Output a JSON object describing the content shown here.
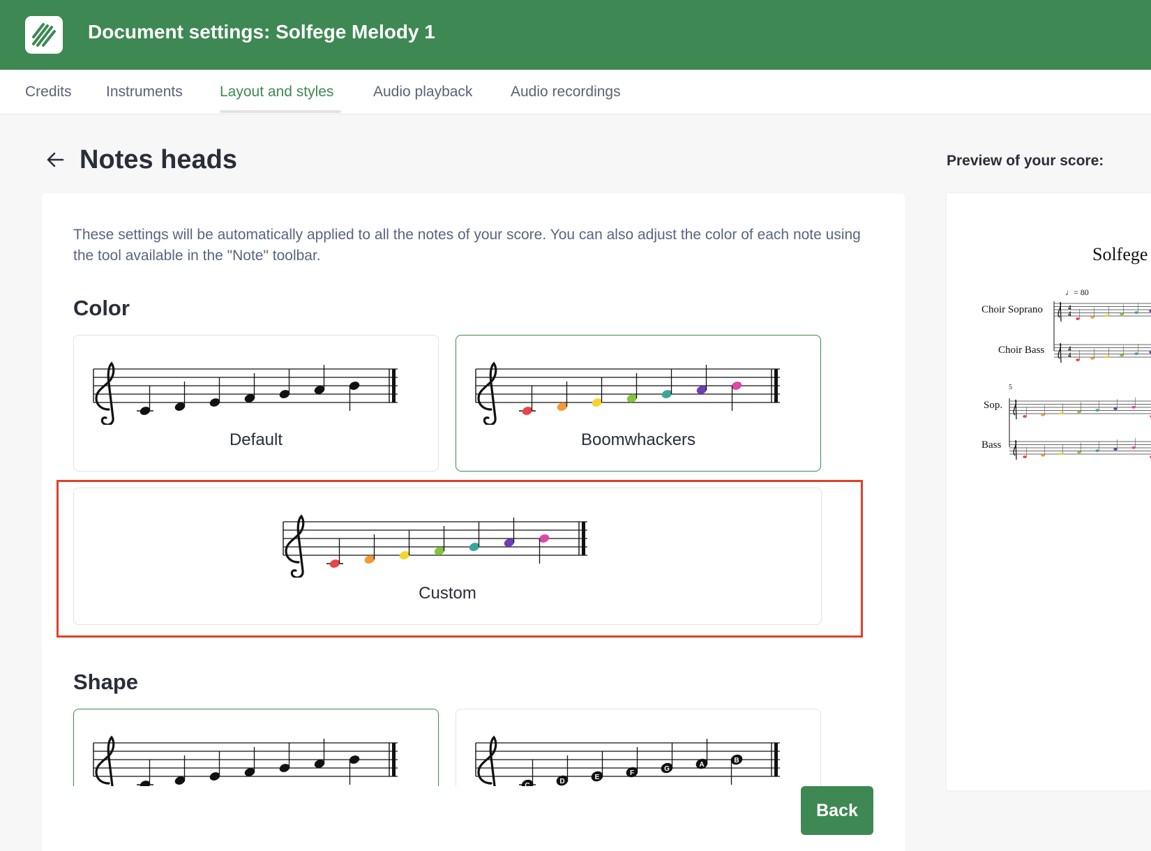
{
  "header": {
    "title": "Document settings: Solfege Melody 1",
    "logo_icon": "hatched-logo-icon"
  },
  "tabs": [
    {
      "label": "Credits",
      "active": false
    },
    {
      "label": "Instruments",
      "active": false
    },
    {
      "label": "Layout and styles",
      "active": true
    },
    {
      "label": "Audio playback",
      "active": false
    },
    {
      "label": "Audio recordings",
      "active": false
    }
  ],
  "page": {
    "title": "Notes heads",
    "back_icon": "arrow-left-icon"
  },
  "description": "These settings will be automatically applied to all the notes of your score. You can also adjust the color of each note using the tool available in the \"Note\" toolbar.",
  "color_section": {
    "heading": "Color",
    "options": [
      {
        "label": "Default",
        "selected": false
      },
      {
        "label": "Boomwhackers",
        "selected": true
      },
      {
        "label": "Custom",
        "selected": false,
        "highlighted": true
      }
    ]
  },
  "shape_section": {
    "heading": "Shape",
    "note_letters": [
      "C",
      "D",
      "E",
      "F",
      "G",
      "A",
      "B"
    ]
  },
  "note_colors": [
    "#e84545",
    "#f29a35",
    "#f5d52d",
    "#86c440",
    "#3aa69a",
    "#6c3fb6",
    "#d84aa8"
  ],
  "default_note_color": "#111111",
  "accent_color": "#3e8853",
  "highlight_color": "#e0402a",
  "preview": {
    "label": "Preview of your score:",
    "score_title": "Solfege",
    "tempo": "= 80",
    "staves": [
      "Choir Soprano",
      "Choir Bass"
    ],
    "short_staves": [
      "Sop.",
      "Bass"
    ],
    "measure_number": "5",
    "time_signature": "4"
  },
  "footer": {
    "back_label": "Back"
  }
}
